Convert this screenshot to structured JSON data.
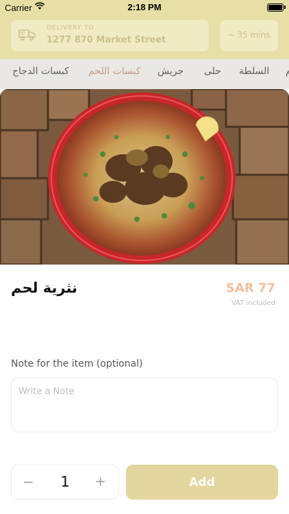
{
  "status_bar": {
    "carrier": "Carrier",
    "time": "2:18 PM"
  },
  "header": {
    "delivery_label": "DELIVERY TO",
    "address": "1277 870 Market Street",
    "eta": "~ 35 mins"
  },
  "categories": [
    {
      "label": "كبسات الدجاج"
    },
    {
      "label": "كبسات اللحم",
      "active": true
    },
    {
      "label": "جريش"
    },
    {
      "label": "حلى"
    },
    {
      "label": "السلطة"
    },
    {
      "label": "م"
    }
  ],
  "item": {
    "name": "نثرية لحم",
    "price": "SAR 77",
    "vat_note": "VAT included"
  },
  "note": {
    "label": "Note for the item (optional)",
    "placeholder": "Write a Note",
    "value": ""
  },
  "order": {
    "minus": "−",
    "quantity": "1",
    "plus": "+",
    "add_label": "Add"
  },
  "colors": {
    "accent": "#e2d59e",
    "price": "#f2c09d",
    "active_category": "#c79b87"
  }
}
